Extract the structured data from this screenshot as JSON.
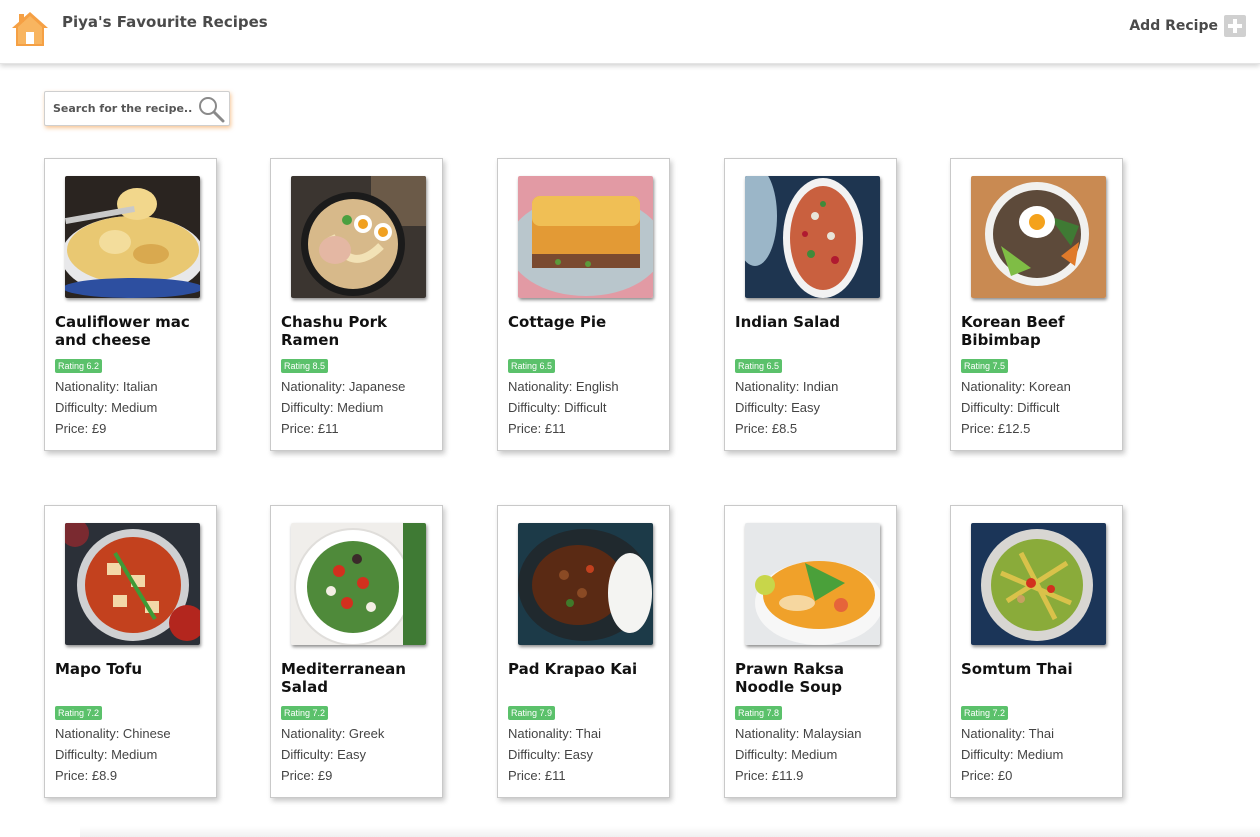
{
  "header": {
    "title": "Piya's Favourite Recipes",
    "add_label": "Add Recipe"
  },
  "search": {
    "placeholder": "Search for the recipe.."
  },
  "recipes": [
    {
      "title": "Cauliflower mac and cheese",
      "rating": "Rating 6.2",
      "nationality": "Nationality: Italian",
      "difficulty": "Difficulty: Medium",
      "price": "Price: £9"
    },
    {
      "title": "Chashu Pork Ramen",
      "rating": "Rating 8.5",
      "nationality": "Nationality: Japanese",
      "difficulty": "Difficulty: Medium",
      "price": "Price: £11"
    },
    {
      "title": "Cottage Pie",
      "rating": "Rating 6.5",
      "nationality": "Nationality: English",
      "difficulty": "Difficulty: Difficult",
      "price": "Price: £11"
    },
    {
      "title": "Indian Salad",
      "rating": "Rating 6.5",
      "nationality": "Nationality: Indian",
      "difficulty": "Difficulty: Easy",
      "price": "Price: £8.5"
    },
    {
      "title": "Korean Beef Bibimbap",
      "rating": "Rating 7.5",
      "nationality": "Nationality: Korean",
      "difficulty": "Difficulty: Difficult",
      "price": "Price: £12.5"
    },
    {
      "title": "Mapo Tofu",
      "rating": "Rating 7.2",
      "nationality": "Nationality: Chinese",
      "difficulty": "Difficulty: Medium",
      "price": "Price: £8.9"
    },
    {
      "title": "Mediterranean Salad",
      "rating": "Rating 7.2",
      "nationality": "Nationality: Greek",
      "difficulty": "Difficulty: Easy",
      "price": "Price: £9"
    },
    {
      "title": "Pad Krapao Kai",
      "rating": "Rating 7.9",
      "nationality": "Nationality: Thai",
      "difficulty": "Difficulty: Easy",
      "price": "Price: £11"
    },
    {
      "title": "Prawn Raksa Noodle Soup",
      "rating": "Rating 7.8",
      "nationality": "Nationality: Malaysian",
      "difficulty": "Difficulty: Medium",
      "price": "Price: £11.9"
    },
    {
      "title": "Somtum Thai",
      "rating": "Rating 7.2",
      "nationality": "Nationality: Thai",
      "difficulty": "Difficulty: Medium",
      "price": "Price: £0"
    }
  ],
  "colors": {
    "accent_orange": "#f5a044",
    "rating_green": "#5bc16b"
  },
  "icons": {
    "home": "home-icon",
    "add": "plus-icon",
    "search": "search-icon"
  }
}
